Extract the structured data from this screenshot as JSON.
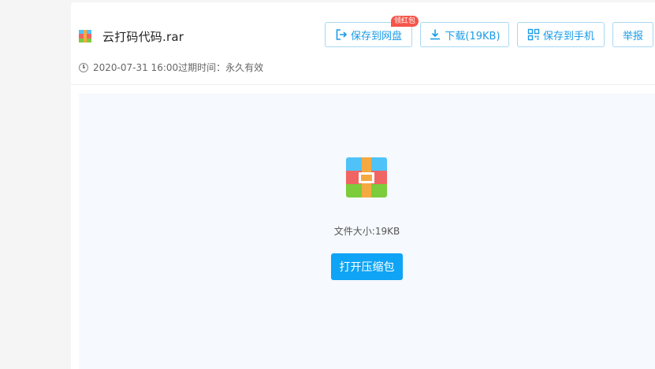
{
  "file": {
    "name": "云打码代码.rar",
    "meta": "2020-07-31 16:00过期时间：永久有效"
  },
  "toolbar": {
    "save_label": "保存到网盘",
    "badge_label": "领红包",
    "download_label": "下载(19KB)",
    "phone_label": "保存到手机",
    "report_label": "举报"
  },
  "preview": {
    "size_label": "文件大小:19KB",
    "open_label": "打开压缩包"
  },
  "colors": {
    "accent": "#1a9be8",
    "primary_button": "#0fa4f5",
    "badge": "#f5554a",
    "preview_bg": "#f6f9fd"
  }
}
